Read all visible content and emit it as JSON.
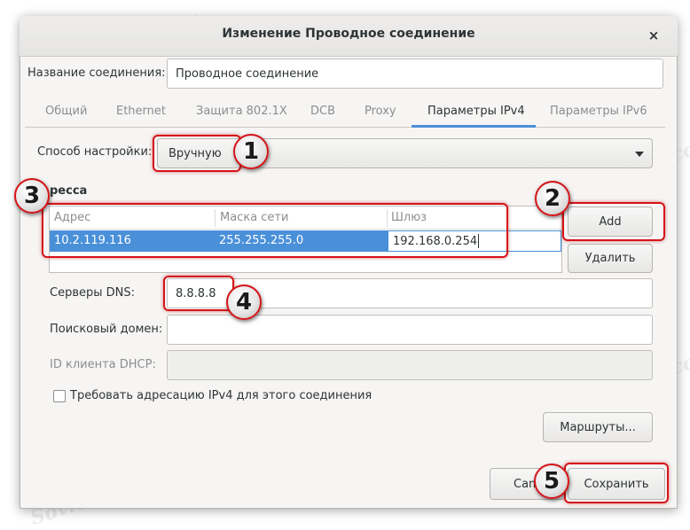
{
  "window": {
    "title": "Изменение Проводное соединение",
    "close_glyph": "×"
  },
  "connection_name": {
    "label": "Название соединения:",
    "value": "Проводное соединение"
  },
  "tabs": [
    {
      "label": "Общий",
      "active": false
    },
    {
      "label": "Ethernet",
      "active": false
    },
    {
      "label": "Защита 802.1X",
      "active": false
    },
    {
      "label": "DCB",
      "active": false
    },
    {
      "label": "Proxy",
      "active": false
    },
    {
      "label": "Параметры IPv4",
      "active": true
    },
    {
      "label": "Параметры IPv6",
      "active": false
    }
  ],
  "method": {
    "label": "Способ настройки:",
    "value": "Вручную"
  },
  "addresses": {
    "section_label": "ресса",
    "columns": [
      "Адрес",
      "Маска сети",
      "Шлюз"
    ],
    "rows": [
      {
        "address": "10.2.119.116",
        "netmask": "255.255.255.0",
        "gateway": "192.168.0.254"
      }
    ],
    "add_label": "Add",
    "delete_label": "Удалить"
  },
  "dns": {
    "label": "Серверы DNS:",
    "value": "8.8.8.8"
  },
  "search_domain": {
    "label": "Поисковый домен:",
    "value": ""
  },
  "dhcp_client": {
    "label": "ID клиента DHCP:",
    "value": ""
  },
  "require_ipv4": {
    "label": "Требовать адресацию IPv4 для этого соединения",
    "checked": false
  },
  "routes_label": "Маршруты...",
  "footer": {
    "cancel_label": "Canc",
    "save_label": "Сохранить"
  },
  "annotations": [
    "1",
    "2",
    "3",
    "4",
    "5"
  ],
  "watermark": "Sovietpcpair.com",
  "colors": {
    "accent": "#4a90d9",
    "annotation": "#d51418"
  }
}
